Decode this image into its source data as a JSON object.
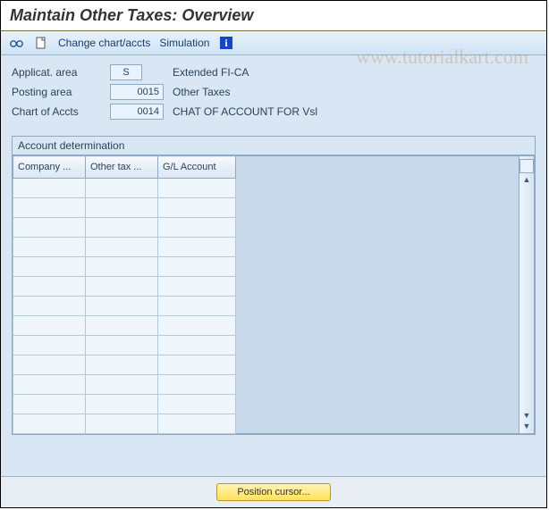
{
  "window": {
    "title": "Maintain Other Taxes: Overview"
  },
  "toolbar": {
    "change_chart_accts": "Change chart/accts",
    "simulation": "Simulation"
  },
  "fields": {
    "applicat_area": {
      "label": "Applicat. area",
      "value": "S",
      "desc": "Extended FI-CA"
    },
    "posting_area": {
      "label": "Posting area",
      "value": "0015",
      "desc": "Other Taxes"
    },
    "chart_of_accts": {
      "label": "Chart of Accts",
      "value": "0014",
      "desc": "CHAT OF ACCOUNT FOR Vsl"
    }
  },
  "panel": {
    "title": "Account determination"
  },
  "table": {
    "columns": [
      "Company ...",
      "Other tax ...",
      "G/L Account"
    ],
    "visible_row_count": 13
  },
  "footer": {
    "position_cursor": "Position cursor..."
  },
  "watermark": "www.tutorialkart.com"
}
